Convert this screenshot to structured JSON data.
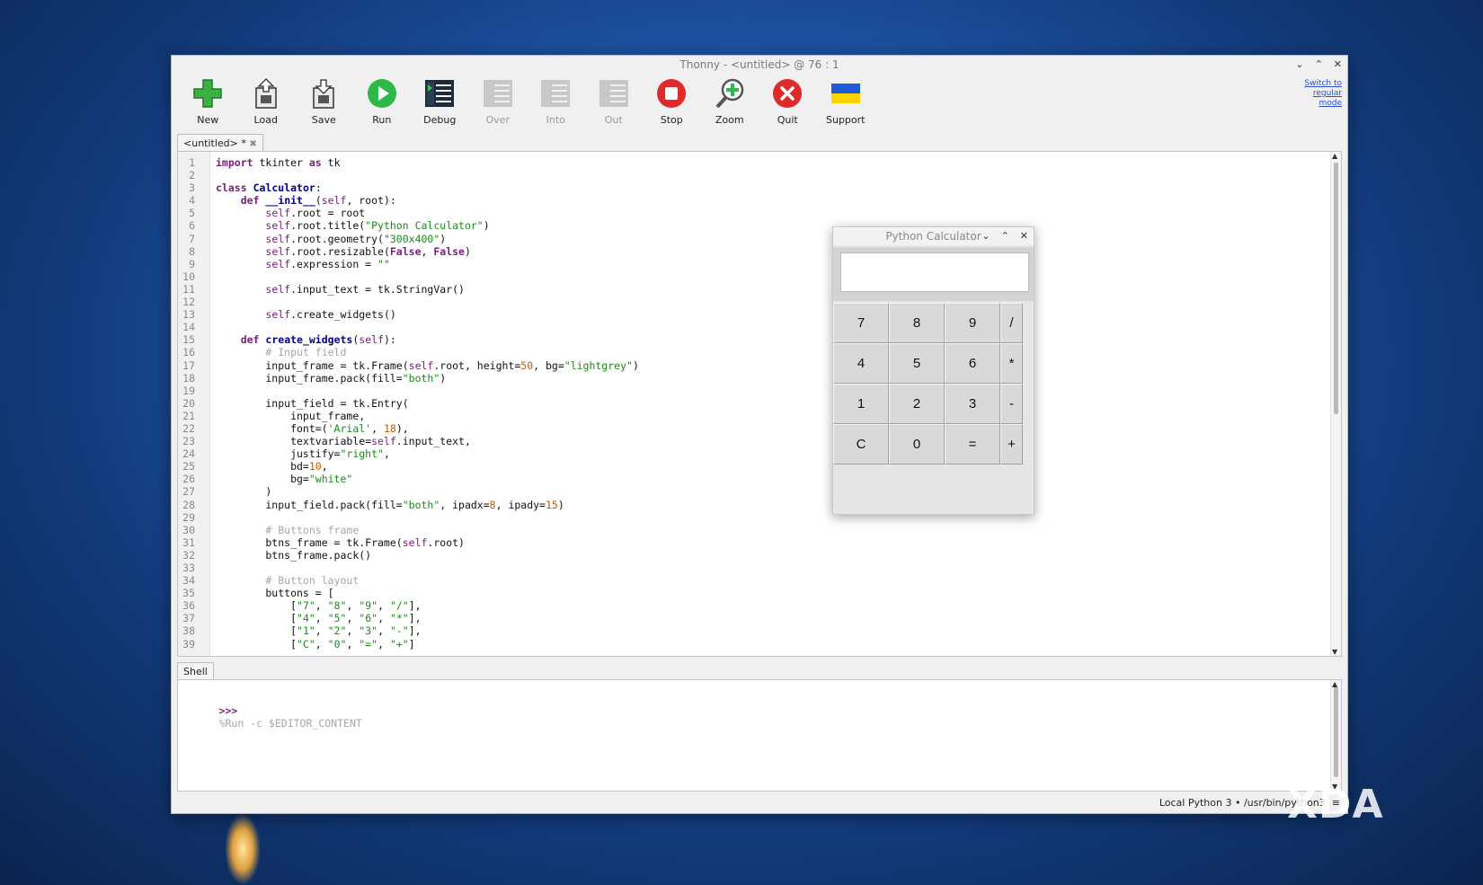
{
  "window": {
    "title": "Thonny  -  <untitled>  @  76 : 1"
  },
  "toolbar": [
    {
      "label": "New",
      "icon": "new-file-icon",
      "enabled": true
    },
    {
      "label": "Load",
      "icon": "load-icon",
      "enabled": true
    },
    {
      "label": "Save",
      "icon": "save-icon",
      "enabled": true
    },
    {
      "label": "Run",
      "icon": "run-icon",
      "enabled": true
    },
    {
      "label": "Debug",
      "icon": "debug-icon",
      "enabled": true
    },
    {
      "label": "Over",
      "icon": "step-over-icon",
      "enabled": false
    },
    {
      "label": "Into",
      "icon": "step-into-icon",
      "enabled": false
    },
    {
      "label": "Out",
      "icon": "step-out-icon",
      "enabled": false
    },
    {
      "label": "Stop",
      "icon": "stop-icon",
      "enabled": true
    },
    {
      "label": "Zoom",
      "icon": "zoom-icon",
      "enabled": true
    },
    {
      "label": "Quit",
      "icon": "quit-icon",
      "enabled": true
    },
    {
      "label": "Support",
      "icon": "ukraine-flag-icon",
      "enabled": true
    }
  ],
  "mode_switch": {
    "line1": "Switch to",
    "line2": "regular",
    "line3": "mode"
  },
  "editor": {
    "tab_label": "<untitled>",
    "tab_marker": "*",
    "code_lines": [
      "import tkinter as tk",
      "",
      "class Calculator:",
      "    def __init__(self, root):",
      "        self.root = root",
      "        self.root.title(\"Python Calculator\")",
      "        self.root.geometry(\"300x400\")",
      "        self.root.resizable(False, False)",
      "        self.expression = \"\"",
      "",
      "        self.input_text = tk.StringVar()",
      "",
      "        self.create_widgets()",
      "",
      "    def create_widgets(self):",
      "        # Input field",
      "        input_frame = tk.Frame(self.root, height=50, bg=\"lightgrey\")",
      "        input_frame.pack(fill=\"both\")",
      "",
      "        input_field = tk.Entry(",
      "            input_frame,",
      "            font=('Arial', 18),",
      "            textvariable=self.input_text,",
      "            justify=\"right\",",
      "            bd=10,",
      "            bg=\"white\"",
      "        )",
      "        input_field.pack(fill=\"both\", ipadx=8, ipady=15)",
      "",
      "        # Buttons frame",
      "        btns_frame = tk.Frame(self.root)",
      "        btns_frame.pack()",
      "",
      "        # Button layout",
      "        buttons = [",
      "            [\"7\", \"8\", \"9\", \"/\"],",
      "            [\"4\", \"5\", \"6\", \"*\"],",
      "            [\"1\", \"2\", \"3\", \"-\"],",
      "            [\"C\", \"0\", \"=\", \"+\"]"
    ]
  },
  "shell": {
    "tab_label": "Shell",
    "prompt": ">>>",
    "command": "%Run -c $EDITOR_CONTENT"
  },
  "status": {
    "interpreter": "Local Python 3  •  /usr/bin/python3"
  },
  "calculator": {
    "title": "Python Calculator",
    "display_value": "",
    "buttons": [
      [
        "7",
        "8",
        "9",
        "/"
      ],
      [
        "4",
        "5",
        "6",
        "*"
      ],
      [
        "1",
        "2",
        "3",
        "-"
      ],
      [
        "C",
        "0",
        "=",
        "+"
      ]
    ]
  },
  "watermark": {
    "text": "XDA"
  }
}
